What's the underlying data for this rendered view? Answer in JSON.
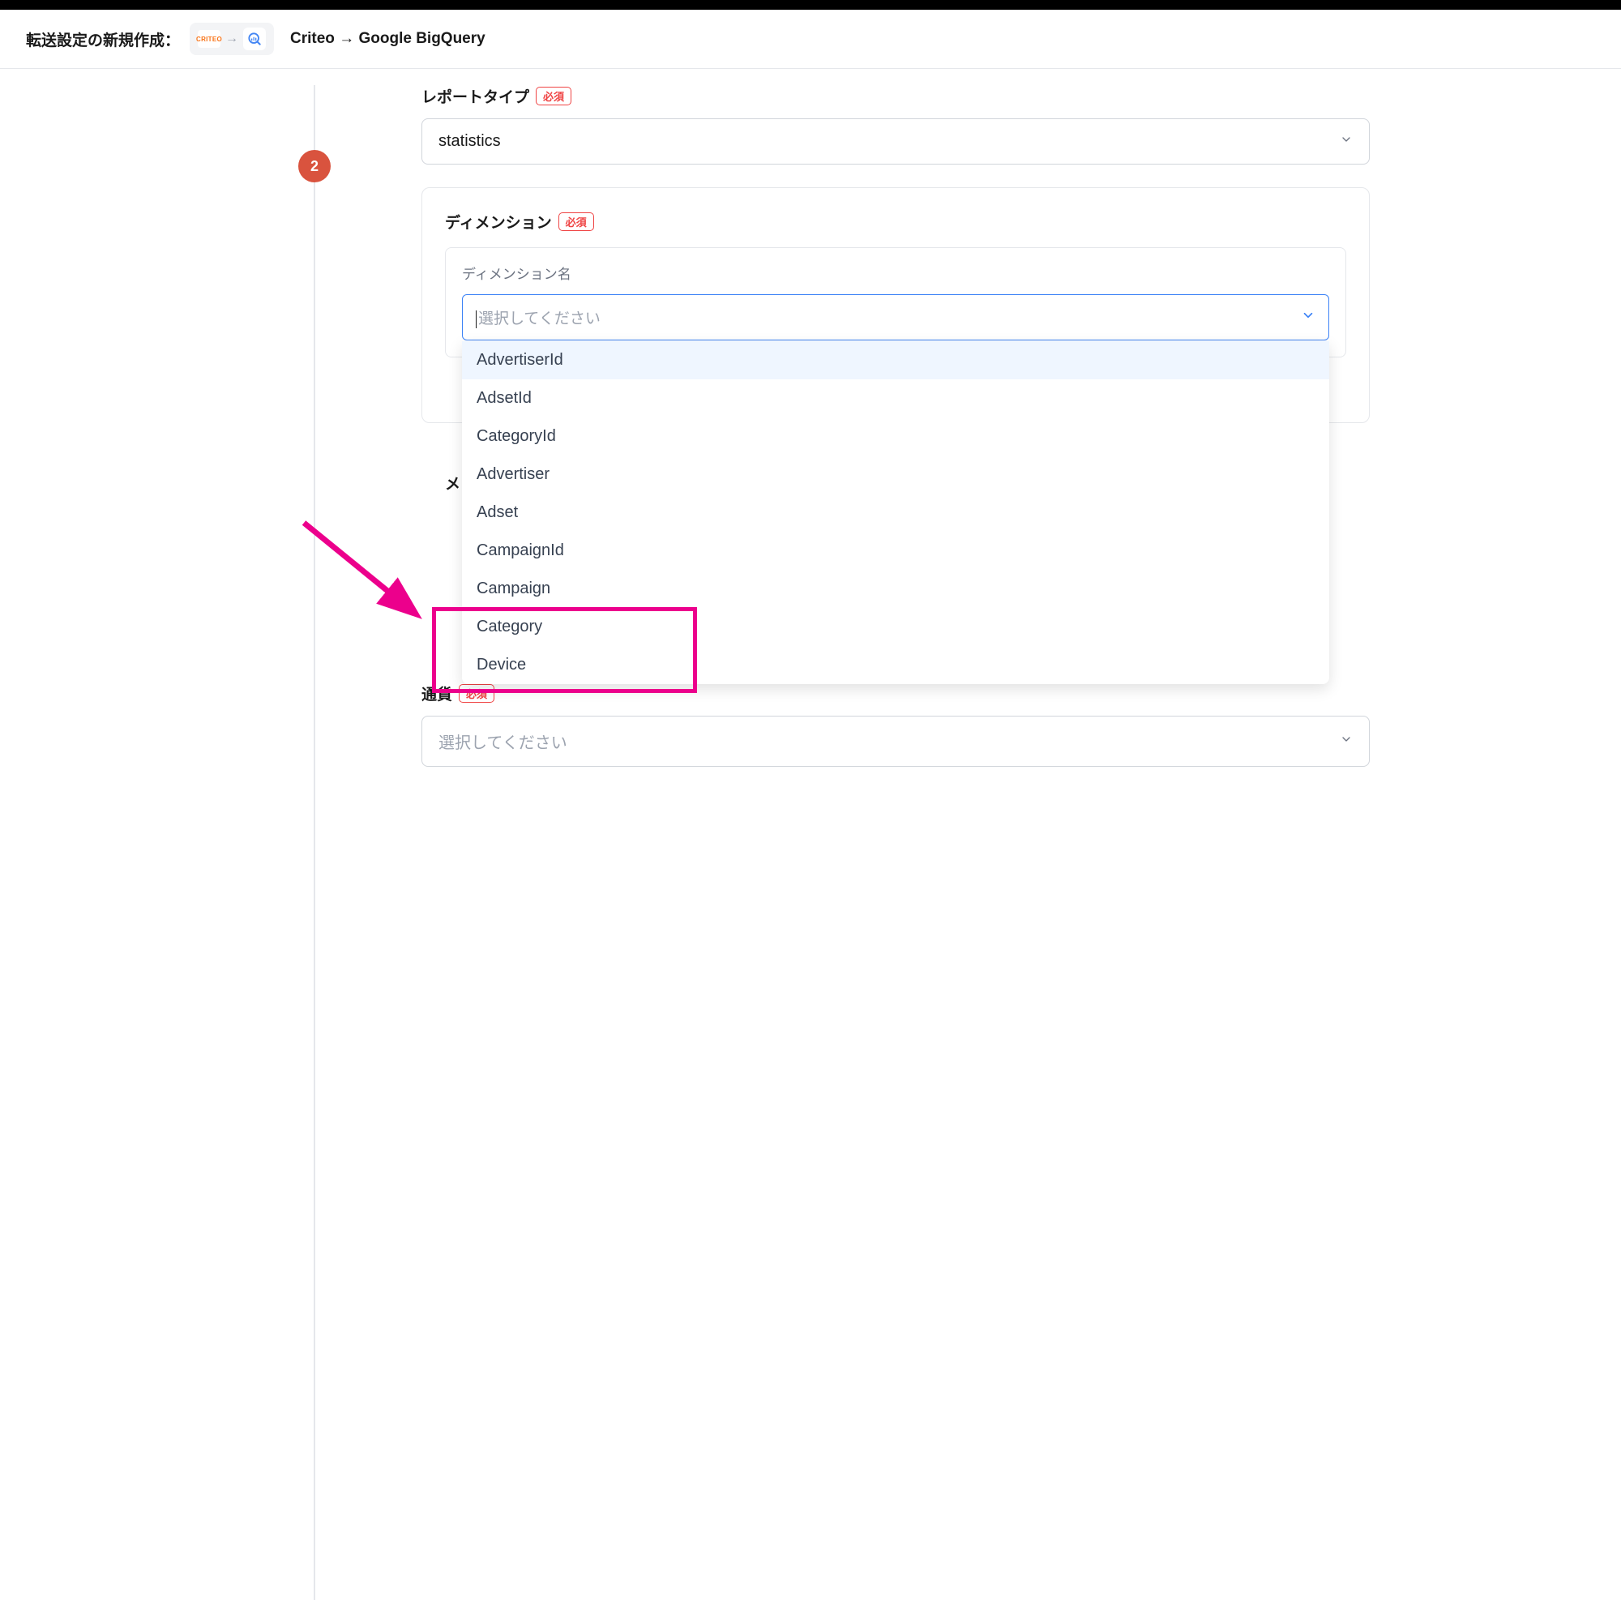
{
  "header": {
    "title": "転送設定の新規作成：",
    "criteo_text": "CRITEO",
    "connection_label": "Criteo → Google BigQuery"
  },
  "step": {
    "number": "2"
  },
  "report_type": {
    "label": "レポートタイプ",
    "required": "必須",
    "value": "statistics"
  },
  "dimension": {
    "label": "ディメンション",
    "required": "必須",
    "column_header": "ディメンション名",
    "placeholder": "選択してください",
    "options": [
      "AdvertiserId",
      "AdsetId",
      "CategoryId",
      "Advertiser",
      "Adset",
      "CampaignId",
      "Campaign",
      "Category",
      "Device"
    ]
  },
  "hidden_section": {
    "label_peek": "メ"
  },
  "currency": {
    "label": "通貨",
    "required": "必須",
    "placeholder": "選択してください"
  }
}
